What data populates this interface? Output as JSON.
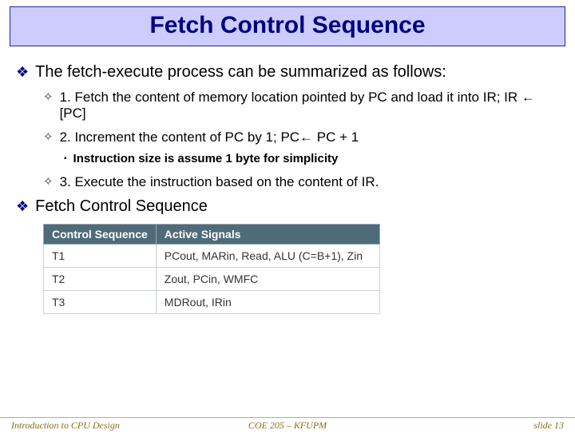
{
  "title": "Fetch Control Sequence",
  "bullets": {
    "b1": "The fetch-execute process can be summarized as follows:",
    "s1": "1. Fetch the content of memory location pointed by PC and load it into IR; IR ← [PC]",
    "s2": "2. Increment the content of PC by 1; PC← PC + 1",
    "s2a": "Instruction size is assume 1 byte for simplicity",
    "s3": "3. Execute the instruction based on the content of IR.",
    "b2": "Fetch Control Sequence"
  },
  "table": {
    "headers": {
      "c1": "Control Sequence",
      "c2": "Active Signals"
    },
    "rows": [
      {
        "c1": "T1",
        "c2": "PCout, MARin, Read, ALU (C=B+1), Zin"
      },
      {
        "c1": "T2",
        "c2": "Zout, PCin, WMFC"
      },
      {
        "c1": "T3",
        "c2": "MDRout, IRin"
      }
    ]
  },
  "footer": {
    "left": "Introduction to CPU Design",
    "center": "COE 205 – KFUPM",
    "right": "slide 13"
  }
}
